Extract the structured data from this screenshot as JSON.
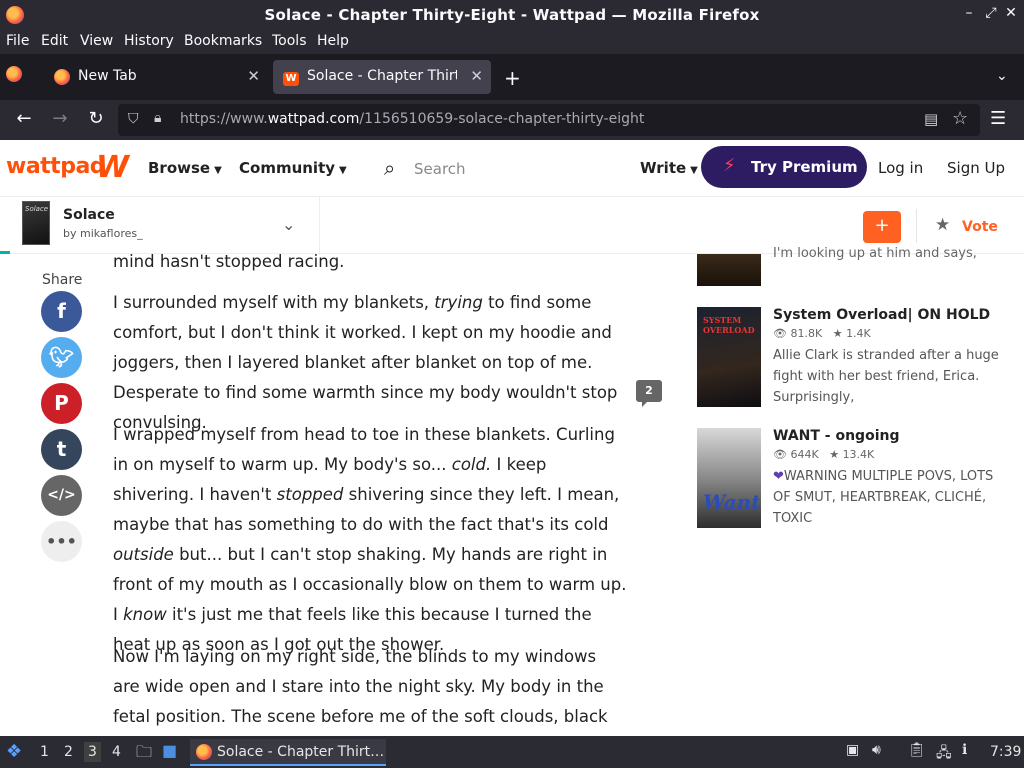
{
  "window": {
    "title": "Solace - Chapter Thirty-Eight - Wattpad — Mozilla Firefox"
  },
  "menu": [
    "File",
    "Edit",
    "View",
    "History",
    "Bookmarks",
    "Tools",
    "Help"
  ],
  "tabs": [
    {
      "label": "New Tab"
    },
    {
      "label": "Solace - Chapter Thirty-E"
    }
  ],
  "address": {
    "prefix": "https://www.",
    "domain": "wattpad.com",
    "path": "/1156510659-solace-chapter-thirty-eight"
  },
  "header": {
    "logo": "wattpad",
    "browse": "Browse",
    "community": "Community",
    "search_placeholder": "Search",
    "write": "Write",
    "premium": "Try Premium",
    "login": "Log in",
    "signup": "Sign Up"
  },
  "story": {
    "title": "Solace",
    "author": "by mikaflores_",
    "cover_text": "Solace",
    "add": "+",
    "vote": "Vote"
  },
  "share": {
    "label": "Share"
  },
  "comment_count": "2",
  "reading": {
    "p0": "mind hasn't stopped racing.",
    "p1": [
      "I surrounded myself with my blankets, ",
      "trying",
      " to find some comfort, but I don't think it worked. I kept on my hoodie and joggers, then I layered blanket after blanket on top of me. Desperate to find some warmth since my body wouldn't stop convulsing."
    ],
    "p2": [
      "I wrapped myself from head to toe in these blankets. Curling in on myself to warm up. My body's so... ",
      "cold.",
      " I keep shivering. I haven't ",
      "stopped",
      " shivering since they left. I mean, maybe that has something to do with the fact that's its cold ",
      "outside",
      " but... but I can't stop shaking. My hands are right in front of my mouth as I occasionally blow on them to warm up. I ",
      "know",
      " it's just me that feels like this because I turned the heat up as soon as I got out the shower."
    ],
    "p3": "Now I'm laying on my right side, the blinds to my windows are wide open and I stare into the night sky. My body in the fetal position. The scene before me of the soft clouds, black sky, and shiny stars make"
  },
  "recommendations": {
    "partial_desc": "I'm looking up at him and says,",
    "items": [
      {
        "title": "System Overload| ON HOLD",
        "reads": "81.8K",
        "votes": "1.4K",
        "desc": "Allie Clark is stranded after a huge fight with her best friend, Erica. Surprisingly,",
        "cover_text": "SYSTEM OVERLOAD"
      },
      {
        "title": "WANT - ongoing",
        "reads": "644K",
        "votes": "13.4K",
        "desc": "WARNING MULTIPLE POVS, LOTS OF SMUT, HEARTBREAK, CLICHÉ, TOXIC",
        "cover_text": "Want"
      }
    ]
  },
  "taskbar": {
    "workspaces": [
      "1",
      "2",
      "3",
      "4"
    ],
    "task": "Solace - Chapter Thirt…",
    "clock": "7:39"
  },
  "colors": {
    "brand": "#ff500a",
    "premium": "#2d1c62",
    "facebook": "#3b5998",
    "twitter": "#55acee",
    "pinterest": "#cb2027",
    "tumblr": "#35465c"
  }
}
